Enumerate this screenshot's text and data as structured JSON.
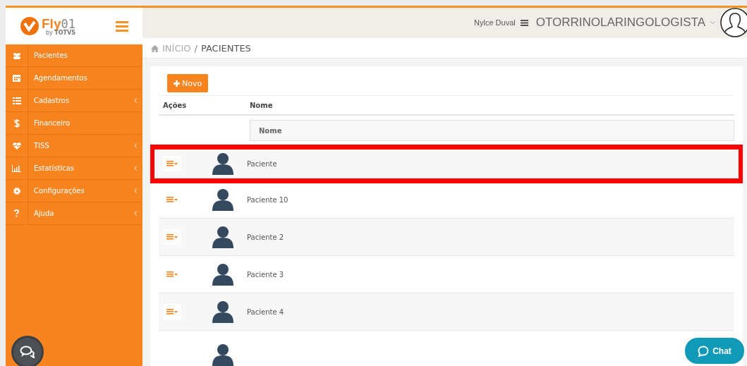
{
  "header": {
    "user_name": "Nylce Duval",
    "specialty": "OTORRINOLARINGOLOGISTA"
  },
  "logo": {
    "name": "Fly",
    "suffix": "01",
    "byline": "by",
    "brand": "TOTVS"
  },
  "sidebar": {
    "items": [
      {
        "label": "Pacientes",
        "submenu": false
      },
      {
        "label": "Agendamentos",
        "submenu": false
      },
      {
        "label": "Cadastros",
        "submenu": true
      },
      {
        "label": "Financeiro",
        "submenu": false
      },
      {
        "label": "TISS",
        "submenu": true
      },
      {
        "label": "Estatísticas",
        "submenu": true
      },
      {
        "label": "Configurações",
        "submenu": true
      },
      {
        "label": "Ajuda",
        "submenu": true
      }
    ]
  },
  "breadcrumb": [
    "INÍCIO",
    "/",
    "PACIENTES"
  ],
  "new_button": "Novo",
  "table": {
    "columns": [
      "Ações",
      "Nome"
    ],
    "filter_placeholder": "Nome",
    "rows": [
      {
        "name": "Paciente",
        "highlighted": true
      },
      {
        "name": "Paciente 10",
        "highlighted": false
      },
      {
        "name": "Paciente 2",
        "highlighted": false
      },
      {
        "name": "Paciente 3",
        "highlighted": false
      },
      {
        "name": "Paciente 4",
        "highlighted": false
      }
    ]
  },
  "chat_button": "Chat"
}
